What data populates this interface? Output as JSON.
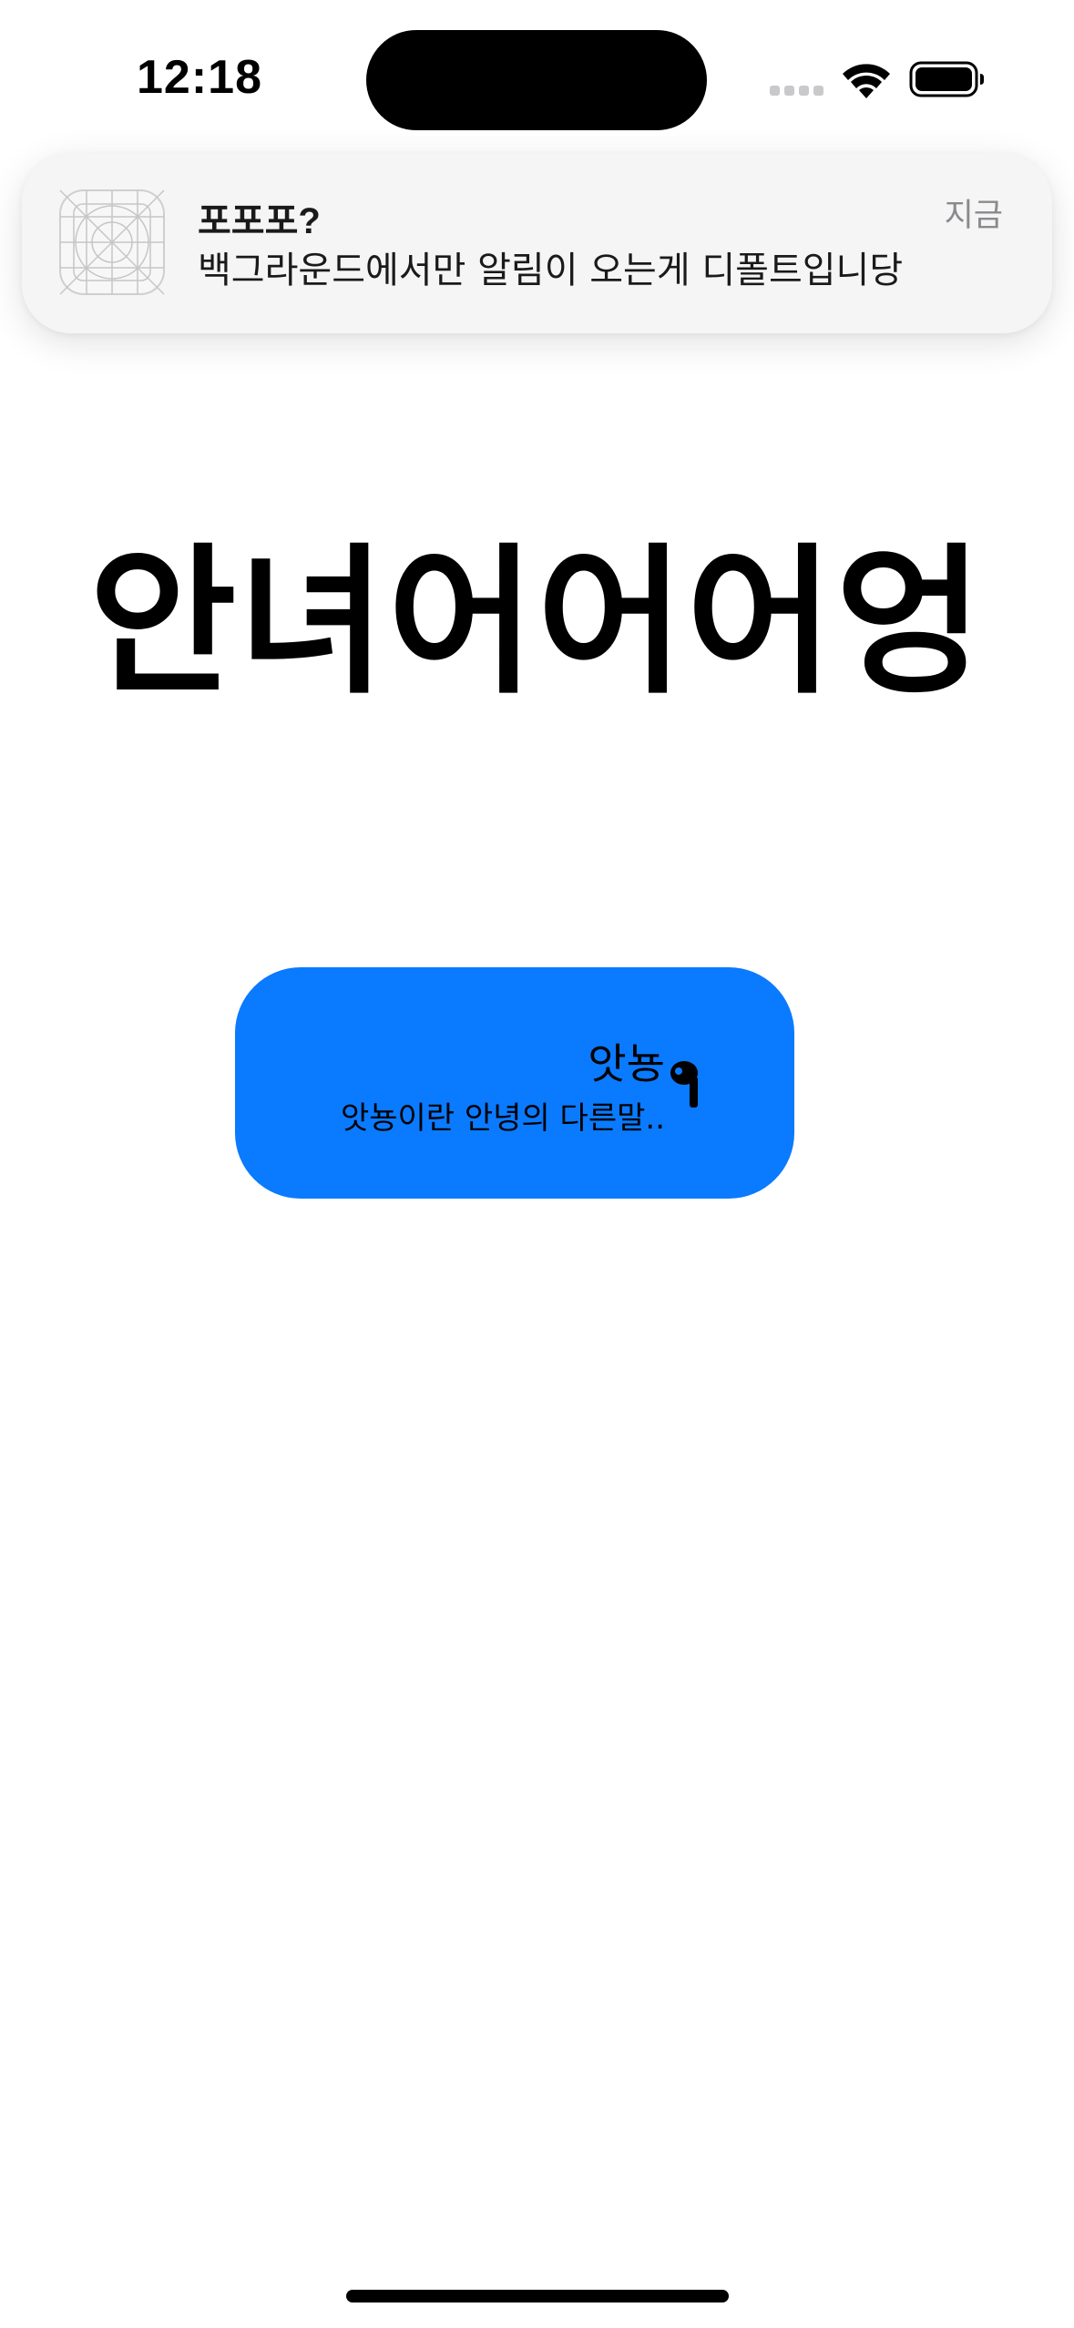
{
  "status_bar": {
    "time": "12:18",
    "icons": [
      "signal-dots-icon",
      "wifi-icon",
      "battery-icon"
    ]
  },
  "notification": {
    "app_icon": "placeholder-app-icon",
    "title": "포포포?",
    "body": "백그라운드에서만 알림이 오는게 디폴트입니당",
    "time": "지금"
  },
  "main": {
    "heading": "안녀어어어엉"
  },
  "button": {
    "title": "앗뇽",
    "subtitle": "앗뇽이란 안녕의 다른말..",
    "icon": "airpod-icon",
    "color": "#0a7aff"
  }
}
